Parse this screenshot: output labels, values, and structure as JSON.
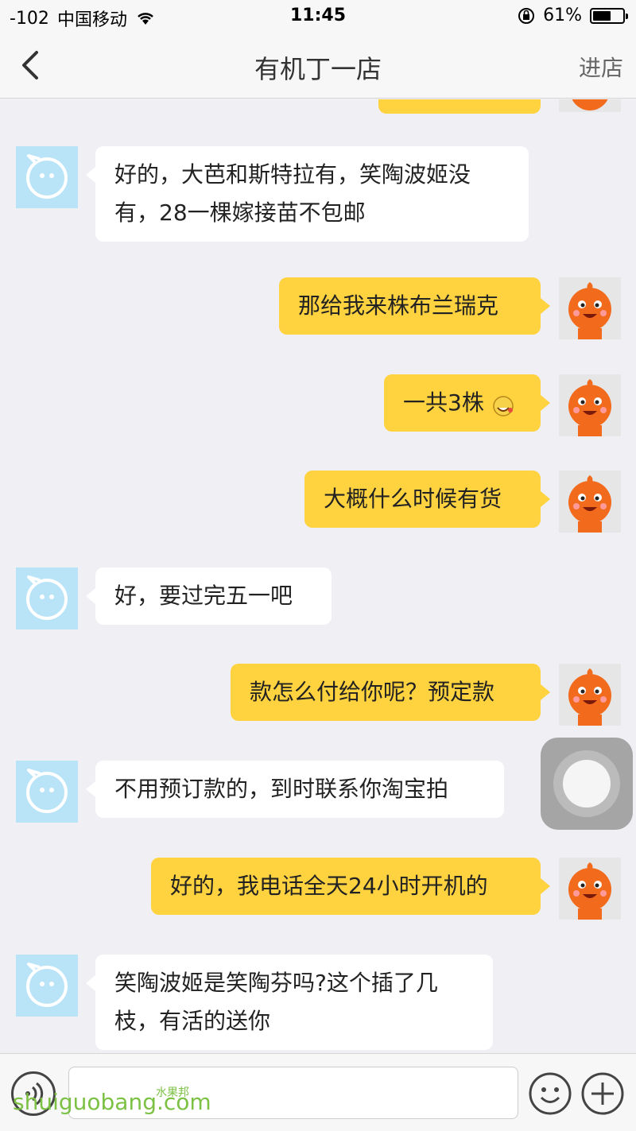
{
  "status_bar": {
    "signal": "-102",
    "carrier": "中国移动",
    "time": "11:45",
    "battery": "61%",
    "battery_level": 0.61
  },
  "navbar": {
    "title": "有机丁一店",
    "enter_store": "进店"
  },
  "messages": [
    {
      "side": "in",
      "text": "好的，大芭和斯特拉有，笑陶波姬没有，28一棵嫁接苗不包邮"
    },
    {
      "side": "out",
      "text": "那给我来株布兰瑞克"
    },
    {
      "side": "out",
      "text": "一共3株"
    },
    {
      "side": "out",
      "text": "大概什么时候有货"
    },
    {
      "side": "in",
      "text": "好，要过完五一吧"
    },
    {
      "side": "out",
      "text": "款怎么付给你呢？预定款"
    },
    {
      "side": "in",
      "text": "不用预订款的，到时联系你淘宝拍"
    },
    {
      "side": "out",
      "text": "好的，我电话全天24小时开机的"
    },
    {
      "side": "in",
      "text": "笑陶波姬是笑陶芬吗?这个插了几枝，有活的送你"
    }
  ],
  "input_bar": {
    "placeholder": ""
  },
  "watermark": {
    "text": "shuiguobang.com",
    "small": "水果邦"
  },
  "colors": {
    "outgoing_bubble": "#ffd23f",
    "incoming_bubble": "#ffffff",
    "background": "#efeff4"
  }
}
